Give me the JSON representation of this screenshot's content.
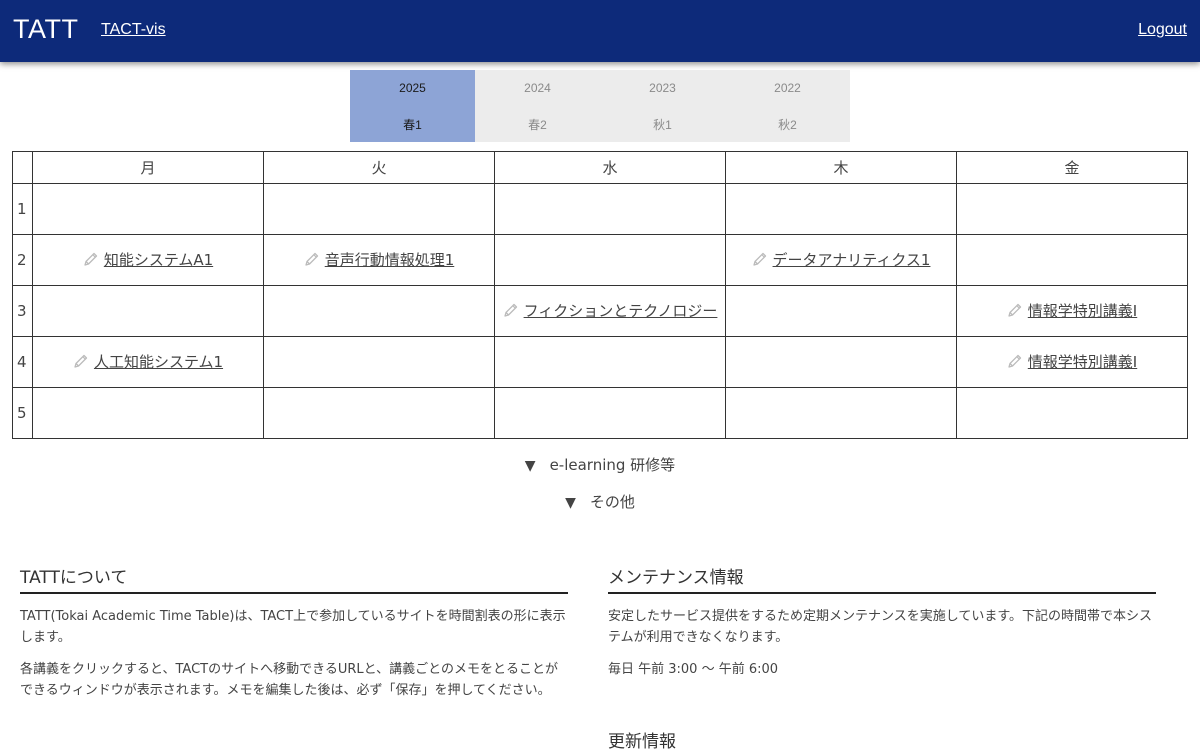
{
  "header": {
    "brand": "TATT",
    "nav_link": "TACT-vis",
    "logout": "Logout"
  },
  "term_selector": {
    "years": [
      "2025",
      "2024",
      "2023",
      "2022"
    ],
    "terms": [
      "春1",
      "春2",
      "秋1",
      "秋2"
    ],
    "active_year": "2025",
    "active_term": "春1"
  },
  "timetable": {
    "days": [
      "月",
      "火",
      "水",
      "木",
      "金"
    ],
    "periods": [
      "1",
      "2",
      "3",
      "4",
      "5"
    ],
    "courses": [
      {
        "period": "2",
        "day": "月",
        "name": "知能システムA1"
      },
      {
        "period": "2",
        "day": "火",
        "name": "音声行動情報処理1"
      },
      {
        "period": "2",
        "day": "木",
        "name": "データアナリティクス1"
      },
      {
        "period": "3",
        "day": "水",
        "name": "フィクションとテクノロジー"
      },
      {
        "period": "3",
        "day": "金",
        "name": "情報学特別講義Ⅰ"
      },
      {
        "period": "4",
        "day": "月",
        "name": "人工知能システム1"
      },
      {
        "period": "4",
        "day": "金",
        "name": "情報学特別講義Ⅰ"
      }
    ]
  },
  "sections": {
    "elearning": "e-learning 研修等",
    "other": "その他"
  },
  "about": {
    "title": "TATTについて",
    "paragraph1": "TATT(Tokai Academic Time Table)は、TACT上で参加しているサイトを時間割表の形に表示します。",
    "paragraph2": "各講義をクリックすると、TACTのサイトへ移動できるURLと、講義ごとのメモをとることができるウィンドウが表示されます。メモを編集した後は、必ず「保存」を押してください。"
  },
  "maintenance": {
    "title": "メンテナンス情報",
    "paragraph": "安定したサービス提供をするため定期メンテナンスを実施しています。下記の時間帯で本システムが利用できなくなります。",
    "schedule": "毎日 午前 3:00 〜 午前 6:00"
  },
  "updates": {
    "title": "更新情報"
  },
  "colors": {
    "header_bg": "#0d2a7a",
    "active_term_bg": "#8da4d6",
    "selector_bg": "#ececec"
  },
  "icons": {
    "course_edit": "pencil-icon",
    "section_toggle": "triangle-down-icon"
  }
}
